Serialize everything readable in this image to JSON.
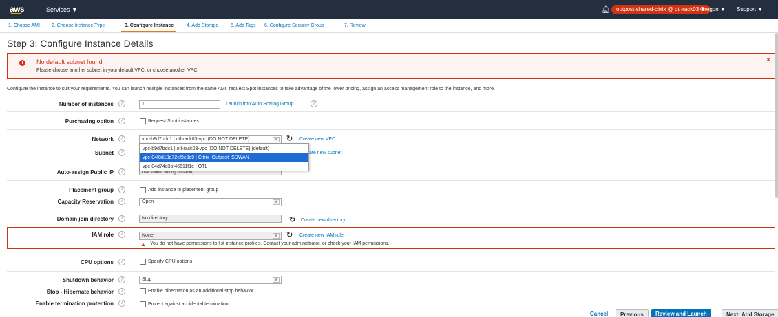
{
  "nav": {
    "logo": "aws",
    "services": "Services ▼",
    "account": "outpost-shared-citrix @ otl-rack03 ▼",
    "region": "Oregon ▼",
    "support": "Support ▼",
    "colors": {
      "bar": "#232f3e",
      "accent": "#ff9900",
      "account_pill": "#d13212"
    }
  },
  "tabs": [
    "1. Choose AMI",
    "2. Choose Instance Type",
    "3. Configure Instance",
    "4. Add Storage",
    "5. Add Tags",
    "6. Configure Security Group",
    "7. Review"
  ],
  "active_tab": 2,
  "page_title": "Step 3: Configure Instance Details",
  "error": {
    "title": "No default subnet found",
    "message": "Please choose another subnet in your default VPC, or choose another VPC.",
    "close": "×"
  },
  "intro": "Configure the instance to suit your requirements. You can launch multiple instances from the same AMI, request Spot instances to take advantage of the lower pricing, assign an access management role to the instance, and more.",
  "info_glyph": "i",
  "form": {
    "number_of_instances": {
      "label": "Number of instances",
      "value": "1",
      "link": "Launch into Auto Scaling Group"
    },
    "purchasing_option": {
      "label": "Purchasing option",
      "checkbox": "Request Spot instances"
    },
    "network": {
      "label": "Network",
      "value": "vpc-b9d7bdc1 | otl-rack03-vpc (DO NOT DELETE)",
      "link": "Create new VPC"
    },
    "subnet": {
      "label": "Subnet",
      "link": "Create new subnet",
      "link_visible_fragment": "ate new subnet"
    },
    "auto_assign_ip": {
      "label": "Auto-assign Public IP",
      "value": "Use subnet setting (Disable)"
    },
    "placement_group": {
      "label": "Placement group",
      "checkbox": "Add instance to placement group"
    },
    "capacity_reservation": {
      "label": "Capacity Reservation",
      "value": "Open"
    },
    "domain_join": {
      "label": "Domain join directory",
      "value": "No directory",
      "link": "Create new directory"
    },
    "iam_role": {
      "label": "IAM role",
      "value": "None",
      "link": "Create new IAM role",
      "warning": "You do not have permissions to list instance profiles. Contact your administrator, or check your IAM permissions."
    },
    "cpu_options": {
      "label": "CPU options",
      "checkbox": "Specify CPU options"
    },
    "shutdown_behavior": {
      "label": "Shutdown behavior",
      "value": "Stop"
    },
    "stop_hibernate": {
      "label": "Stop - Hibernate behavior",
      "checkbox": "Enable hibernation as an additional stop behavior"
    },
    "termination_protection": {
      "label": "Enable termination protection",
      "checkbox": "Protect against accidental termination"
    }
  },
  "network_dropdown": {
    "options": [
      "vpc-b9d7bdc1 | otl-rack03-vpc (DO NOT DELETE) (default)",
      "vpc-04f8d18a72ef9c3a9 | Citrix_Outpost_SDWAN",
      "vpc-04d74d3bf46611f1e | OTL"
    ],
    "highlighted_index": 1
  },
  "footer": {
    "cancel": "Cancel",
    "previous": "Previous",
    "review": "Review and Launch",
    "next": "Next: Add Storage"
  }
}
